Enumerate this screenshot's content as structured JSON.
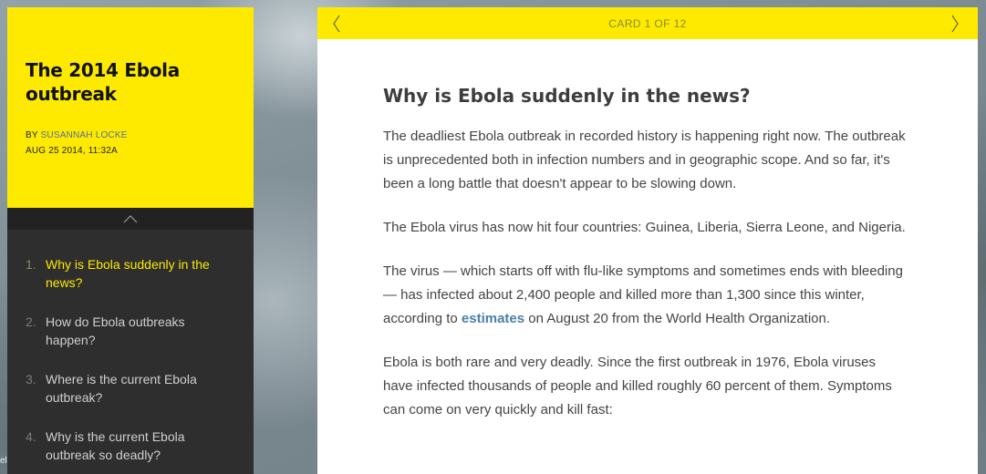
{
  "sidebar": {
    "title": "The 2014 Ebola outbreak",
    "byline_prefix": "BY ",
    "author": "SUSANNAH LOCKE",
    "date": "AUG 25 2014, 11:32A",
    "toc": [
      {
        "num": "1.",
        "label": "Why is Ebola suddenly in the news?"
      },
      {
        "num": "2.",
        "label": "How do Ebola outbreaks happen?"
      },
      {
        "num": "3.",
        "label": "Where is the current Ebola outbreak?"
      },
      {
        "num": "4.",
        "label": "Why is the current Ebola outbreak so deadly?"
      }
    ]
  },
  "card": {
    "counter": "CARD 1 OF 12",
    "title": "Why is Ebola suddenly in the news?",
    "p1": "The deadliest Ebola outbreak in recorded history is happening right now. The outbreak is unprecedented both in infection numbers and in geographic scope. And so far, it's been a long battle that doesn't appear to be slowing down.",
    "p2": "The Ebola virus has now hit four countries: Guinea, Liberia, Sierra Leone, and Nigeria.",
    "p3_before": "The virus — which starts off with flu-like symptoms and sometimes ends with bleeding — has infected about 2,400 people and killed more than 1,300 since this winter, according to ",
    "p3_link": "estimates",
    "p3_after": " on August 20 from the World Health Organization.",
    "p4": "Ebola is both rare and very deadly. Since the first outbreak in 1976, Ebola viruses have infected thousands of people and killed roughly 60 percent of them. Symptoms can come on very quickly and kill fast:"
  },
  "edge_text": "el",
  "icons": {
    "collapse": "chevron-up-icon",
    "prev": "chevron-left-icon",
    "next": "chevron-right-icon"
  },
  "colors": {
    "accent_yellow": "#fdea00",
    "sidebar_dark": "#2e2e2e",
    "link_blue": "#4a7fa5"
  }
}
